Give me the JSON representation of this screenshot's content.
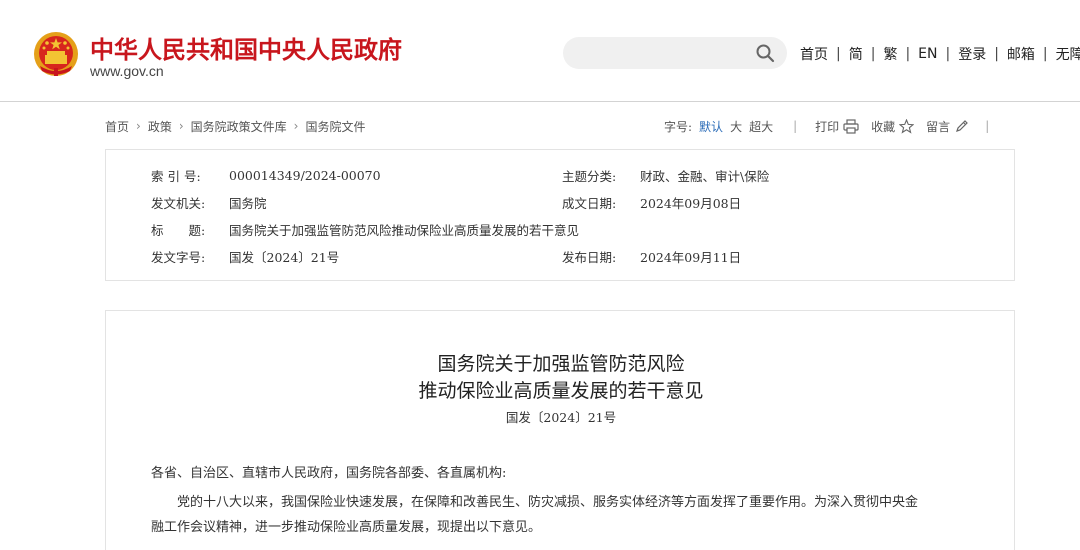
{
  "header": {
    "site_title": "中华人民共和国中央人民政府",
    "site_domain": "www.gov.cn",
    "search_placeholder": "",
    "nav": [
      "首页",
      "简",
      "繁",
      "EN",
      "登录",
      "邮箱",
      "无障碍"
    ]
  },
  "breadcrumb": [
    "首页",
    "政策",
    "国务院政策文件库",
    "国务院文件"
  ],
  "toolbar": {
    "font_size_label": "字号:",
    "font_sizes": [
      "默认",
      "大",
      "超大"
    ],
    "print": "打印",
    "favorite": "收藏",
    "comment": "留言"
  },
  "meta": {
    "index_label": "索 引 号:",
    "index_value": "000014349/2024-00070",
    "topic_label": "主题分类:",
    "topic_value": "财政、金融、审计\\保险",
    "issuer_label": "发文机关:",
    "issuer_value": "国务院",
    "created_label": "成文日期:",
    "created_value": "2024年09月08日",
    "title_label": "标　　题:",
    "title_value": "国务院关于加强监管防范风险推动保险业高质量发展的若干意见",
    "docno_label": "发文字号:",
    "docno_value": "国发〔2024〕21号",
    "published_label": "发布日期:",
    "published_value": "2024年09月11日"
  },
  "article": {
    "title_line1": "国务院关于加强监管防范风险",
    "title_line2": "推动保险业高质量发展的若干意见",
    "doc_number": "国发〔2024〕21号",
    "salutation": "各省、自治区、直辖市人民政府，国务院各部委、各直属机构:",
    "para1_line1": "党的十八大以来，我国保险业快速发展，在保障和改善民生、防灾减损、服务实体经济等方面发挥了重要作用。为深入贯彻中央金",
    "para1_line2": "融工作会议精神，进一步推动保险业高质量发展，现提出以下意见。"
  },
  "colors": {
    "brand_red": "#c8161d",
    "active_blue": "#2b6cb8"
  },
  "icons": {
    "emblem": "national-emblem-icon",
    "search": "search-icon",
    "print": "printer-icon",
    "favorite": "star-icon",
    "comment": "pencil-icon",
    "breadcrumb_separator": "chevron-right-icon"
  }
}
